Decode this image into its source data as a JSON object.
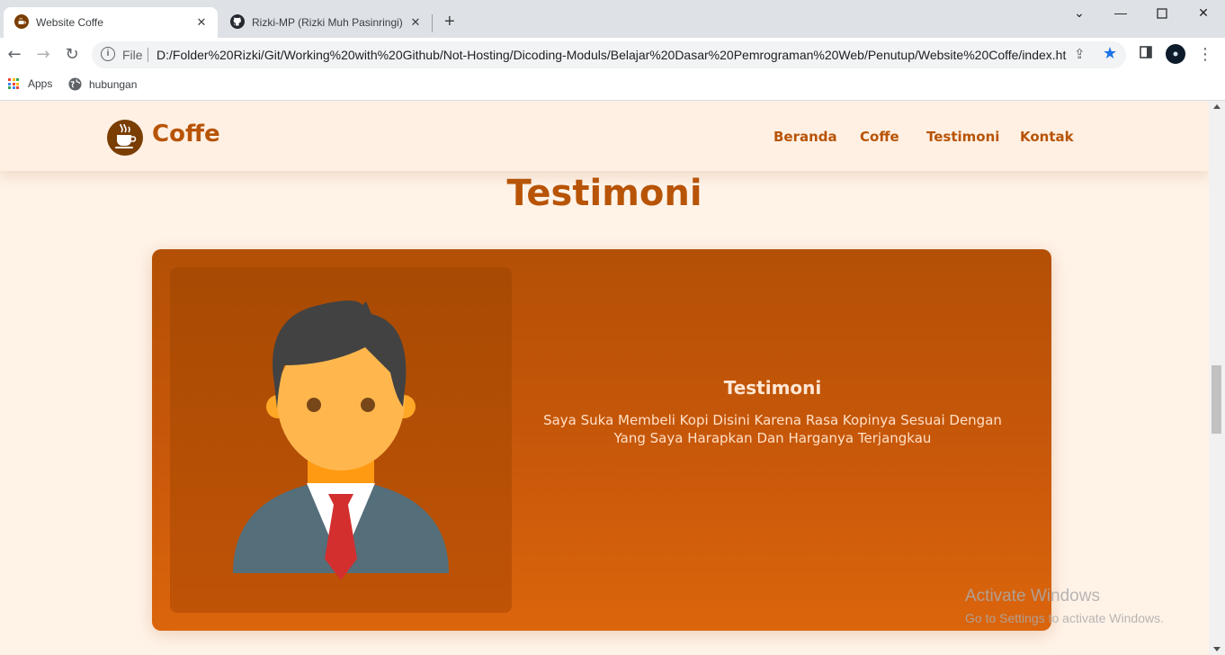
{
  "browser": {
    "tabs": [
      {
        "title": "Website Coffe",
        "icon": "coffee-favicon",
        "active": true
      },
      {
        "title": "Rizki-MP (Rizki Muh Pasinringi)",
        "icon": "github-icon",
        "active": false
      }
    ],
    "new_tab": "+",
    "address": {
      "scheme_label": "File",
      "url": "D:/Folder%20Rizki/Git/Working%20with%20Github/Not-Hosting/Dicoding-Moduls/Belajar%20Dasar%20Pemrograman%20Web/Penutup/Website%20Coffe/index.html"
    },
    "bookmarks": [
      {
        "label": "Apps",
        "icon": "apps-grid-icon"
      },
      {
        "label": "hubungan",
        "icon": "globe-icon"
      }
    ]
  },
  "site": {
    "logo_text": "Coffe",
    "nav": [
      "Beranda",
      "Coffe",
      "Testimoni",
      "Kontak"
    ],
    "section_title": "Testimoni",
    "testimonial": {
      "title": "Testimoni",
      "text": "Saya Suka Membeli Kopi Disini Karena Rasa Kopinya Sesuai Dengan Yang Saya Harapkan Dan Harganya Terjangkau"
    }
  },
  "overlay": {
    "activate_title": "Activate Windows",
    "activate_sub": "Go to Settings to activate Windows."
  },
  "colors": {
    "brand": "#b85406",
    "page_bg": "#fff3e8",
    "card": "#c9580a"
  }
}
